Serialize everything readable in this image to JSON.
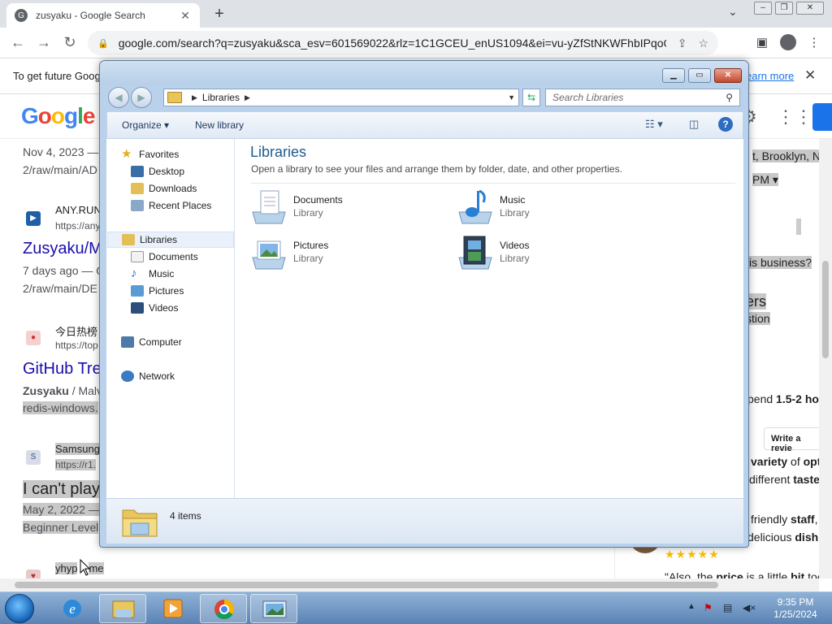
{
  "browser": {
    "tab_title": "zusyaku - Google Search",
    "new_tab": "+",
    "url": "google.com/search?q=zusyaku&sca_esv=601569022&rlz=1C1GCEU_enUS1094&ei=vu-yZfStNKWFhbIPqoOa8A...",
    "infobar_text": "To get future Goog",
    "infobar_link": "earn more"
  },
  "google": {
    "logo": [
      "G",
      "o",
      "o",
      "g",
      "l",
      "e"
    ]
  },
  "results": {
    "r1_date": "Nov 4, 2023 — C",
    "r1_path": "2/raw/main/AD",
    "r2_site": "ANY.RUN",
    "r2_cite": "https://any",
    "r2_title": "Zusyaku/M",
    "r2_date": "7 days ago — O",
    "r2_path": "2/raw/main/DE",
    "r3_site": "今日热榜",
    "r3_cite": "https://top",
    "r3_title": "GitHub Tre",
    "r3_snip_bold": "Zusyaku",
    "r3_snip": " / Malv",
    "r3_snip2": "redis-windows.",
    "r4_site": "Samsung",
    "r4_cite": "https://r1.",
    "r4_title": "I can't play",
    "r4_date": "May 2, 2022 —",
    "r4_snip": "Beginner Level",
    "r5_site": "yhyp",
    "r5_site2": "me"
  },
  "right_panel": {
    "address": "t, Brooklyn, NY",
    "hours": "PM ▾",
    "q": "is business?",
    "h1": "ers",
    "h2": "stion",
    "spend_pre": "pend ",
    "spend_bold": "1.5-2 hou",
    "write_review": "Write a revie",
    "v1_bold": "variety",
    "v1_rest": " of ",
    "v1_bold2": "opt",
    "v2": "different ",
    "v2_bold": "taste",
    "f1": "friendly ",
    "f1_bold": "staff",
    "f1_rest": ",",
    "f2": "delicious ",
    "f2_bold": "dish",
    "stars": "★★★★★",
    "also": "\"Also, the ",
    "also_bold": "price",
    "also_rest": " is a little ",
    "also_bold2": "bit",
    "also_rest2": " too"
  },
  "explorer": {
    "breadcrumb": "Libraries",
    "search_placeholder": "Search Libraries",
    "organize": "Organize",
    "new_library": "New library",
    "nav": {
      "favorites": "Favorites",
      "desktop": "Desktop",
      "downloads": "Downloads",
      "recent": "Recent Places",
      "libraries": "Libraries",
      "documents": "Documents",
      "music": "Music",
      "pictures": "Pictures",
      "videos": "Videos",
      "computer": "Computer",
      "network": "Network"
    },
    "heading": "Libraries",
    "subheading": "Open a library to see your files and arrange them by folder, date, and other properties.",
    "items": [
      {
        "name": "Documents",
        "type": "Library"
      },
      {
        "name": "Music",
        "type": "Library"
      },
      {
        "name": "Pictures",
        "type": "Library"
      },
      {
        "name": "Videos",
        "type": "Library"
      }
    ],
    "item_count": "4 items"
  },
  "taskbar": {
    "time": "9:35 PM",
    "date": "1/25/2024"
  }
}
